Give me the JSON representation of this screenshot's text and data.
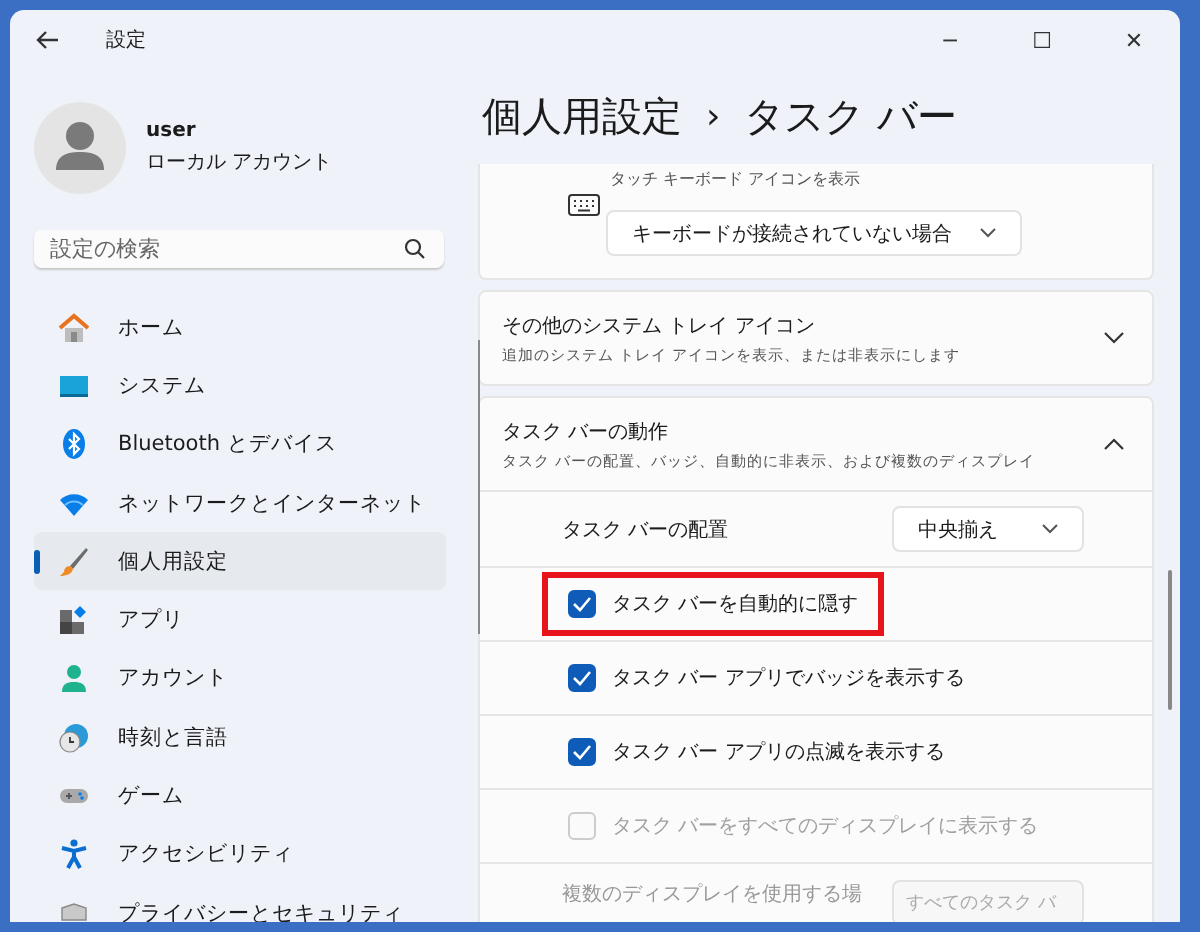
{
  "window": {
    "title": "設定",
    "controls": [
      "─",
      "☐",
      "✕"
    ]
  },
  "profile": {
    "name": "user",
    "account": "ローカル アカウント"
  },
  "search": {
    "placeholder": "設定の検索"
  },
  "nav": [
    {
      "label": "ホーム",
      "selected": false
    },
    {
      "label": "システム",
      "selected": false
    },
    {
      "label": "Bluetooth とデバイス",
      "selected": false
    },
    {
      "label": "ネットワークとインターネット",
      "selected": false
    },
    {
      "label": "個人用設定",
      "selected": true
    },
    {
      "label": "アプリ",
      "selected": false
    },
    {
      "label": "アカウント",
      "selected": false
    },
    {
      "label": "時刻と言語",
      "selected": false
    },
    {
      "label": "ゲーム",
      "selected": false
    },
    {
      "label": "アクセシビリティ",
      "selected": false
    },
    {
      "label": "プライバシーとセキュリティ",
      "selected": false
    }
  ],
  "breadcrumb": {
    "parent": "個人用設定",
    "separator": "›",
    "current": "タスク バー"
  },
  "touch_keyboard": {
    "description": "タッチ キーボード アイコンを表示",
    "dropdown": "キーボードが接続されていない場合"
  },
  "sections": [
    {
      "title": "その他のシステム トレイ アイコン",
      "description": "追加のシステム トレイ アイコンを表示、または非表示にします",
      "expanded": false
    },
    {
      "title": "タスク バーの動作",
      "description": "タスク バーの配置、バッジ、自動的に非表示、および複数のディスプレイ",
      "expanded": true
    }
  ],
  "behaviors": [
    {
      "kind": "dropdown",
      "label": "タスク バーの配置",
      "value": "中央揃え"
    },
    {
      "kind": "checkbox",
      "label": "タスク バーを自動的に隠す",
      "checked": true,
      "disabled": false,
      "highlighted": true
    },
    {
      "kind": "checkbox",
      "label": "タスク バー アプリでバッジを表示する",
      "checked": true,
      "disabled": false,
      "highlighted": false
    },
    {
      "kind": "checkbox",
      "label": "タスク バー アプリの点滅を表示する",
      "checked": true,
      "disabled": false,
      "highlighted": false
    },
    {
      "kind": "checkbox",
      "label": "タスク バーをすべてのディスプレイに表示する",
      "checked": false,
      "disabled": true,
      "highlighted": false
    },
    {
      "kind": "dropdown_disabled",
      "label": "複数のディスプレイを使用する場",
      "value": "すべてのタスク バ"
    }
  ]
}
